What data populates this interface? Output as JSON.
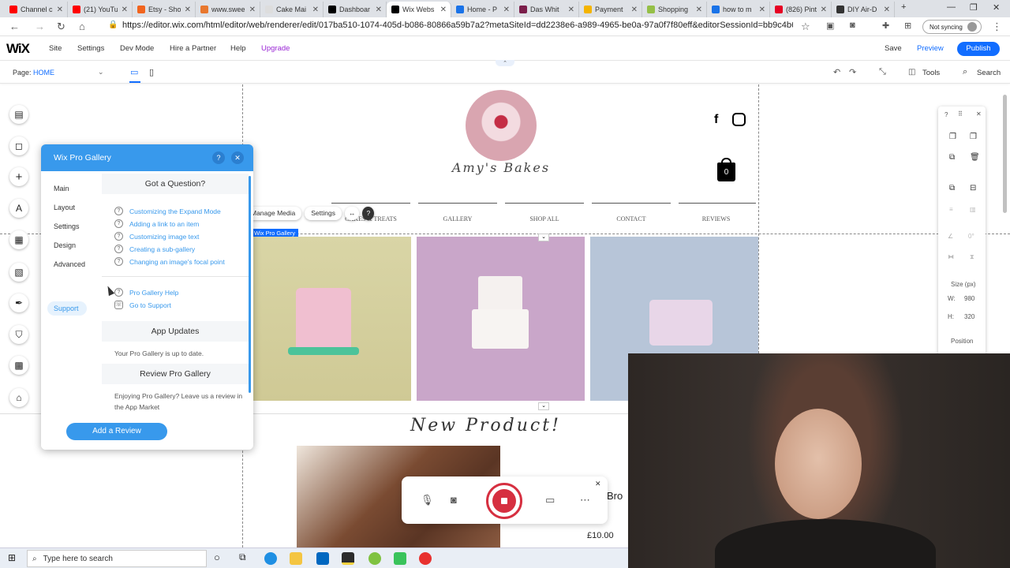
{
  "browser": {
    "tabs": [
      {
        "label": "Channel c",
        "color": "#ff0000"
      },
      {
        "label": "(21) YouTu",
        "color": "#ff0000"
      },
      {
        "label": "Etsy - Sho",
        "color": "#f1641e"
      },
      {
        "label": "www.swee",
        "color": "#e8772e"
      },
      {
        "label": "Cake Mai",
        "color": "#dddddd"
      },
      {
        "label": "Dashboar",
        "color": "#000000"
      },
      {
        "label": "Wix Webs",
        "color": "#000000"
      },
      {
        "label": "Home - P",
        "color": "#1a73e8"
      },
      {
        "label": "Das Whit",
        "color": "#7b1e4a"
      },
      {
        "label": "Payment",
        "color": "#f4b400"
      },
      {
        "label": "Shopping",
        "color": "#95bf47"
      },
      {
        "label": "how to m",
        "color": "#1a73e8"
      },
      {
        "label": "(826) Pint",
        "color": "#e60023"
      },
      {
        "label": "DIY Air-D",
        "color": "#333333"
      }
    ],
    "url": "https://editor.wix.com/html/editor/web/renderer/edit/017ba510-1074-405d-b086-80866a59b7a2?metaSiteId=dd2238e6-a989-4965-be0a-97a0f7f80eff&editorSessionId=bb9c4b6...",
    "sync_label": "Not syncing"
  },
  "wix": {
    "logo": "WiX",
    "menu": [
      "Site",
      "Settings",
      "Dev Mode",
      "Hire a Partner",
      "Help",
      "Upgrade"
    ],
    "save": "Save",
    "preview": "Preview",
    "publish": "Publish",
    "page_prefix": "Page:",
    "page_name": "HOME",
    "tools": "Tools",
    "search": "Search"
  },
  "site": {
    "brand": "Amy's Bakes",
    "nav": [
      "CAKES & TREATS",
      "GALLERY",
      "SHOP ALL",
      "CONTACT",
      "REVIEWS"
    ],
    "cart_count": "0",
    "gallery_label": "Wix Pro Gallery",
    "toolbar": [
      "Manage Media",
      "Settings"
    ],
    "new_product": "New Product!",
    "product_name": "Bro",
    "product_price": "£10.00"
  },
  "right_panel": {
    "size_label": "Size (px)",
    "w_label": "W:",
    "w_value": "980",
    "h_label": "H:",
    "h_value": "320",
    "position_label": "Position",
    "rotation": "0°"
  },
  "pro_gallery": {
    "title": "Wix Pro Gallery",
    "nav": [
      "Main",
      "Layout",
      "Settings",
      "Design",
      "Advanced",
      "Support"
    ],
    "sec_question": "Got a Question?",
    "faq": [
      "Customizing the Expand Mode",
      "Adding a link to an item",
      "Customizing image text",
      "Creating a sub-gallery",
      "Changing an image's focal point"
    ],
    "help_link": "Pro Gallery Help",
    "support_link": "Go to Support",
    "sec_updates": "App Updates",
    "updates_text": "Your Pro Gallery is up to date.",
    "sec_review": "Review Pro Gallery",
    "review_text": "Enjoying Pro Gallery? Leave us a review in the App Market",
    "review_button": "Add a Review"
  },
  "taskbar": {
    "search_placeholder": "Type here to search"
  }
}
